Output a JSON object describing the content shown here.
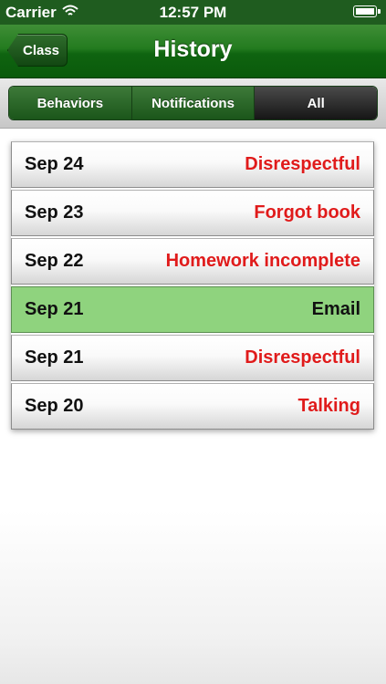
{
  "status_bar": {
    "carrier": "Carrier",
    "wifi_icon": "wifi-icon",
    "time": "12:57 PM",
    "battery_icon": "battery-icon"
  },
  "nav": {
    "back_label": "Class",
    "title": "History"
  },
  "segments": {
    "behaviors": "Behaviors",
    "notifications": "Notifications",
    "all": "All",
    "selected": "All"
  },
  "history": [
    {
      "date": "Sep 24",
      "label": "Disrespectful",
      "type": "behavior"
    },
    {
      "date": "Sep 23",
      "label": "Forgot book",
      "type": "behavior"
    },
    {
      "date": "Sep 22",
      "label": "Homework incomplete",
      "type": "behavior"
    },
    {
      "date": "Sep 21",
      "label": "Email",
      "type": "notification"
    },
    {
      "date": "Sep 21",
      "label": "Disrespectful",
      "type": "behavior"
    },
    {
      "date": "Sep 20",
      "label": "Talking",
      "type": "behavior"
    }
  ],
  "colors": {
    "nav_green": "#1f6b1c",
    "behavior_text": "#e01b1b",
    "notification_row": "#8fd37e"
  }
}
